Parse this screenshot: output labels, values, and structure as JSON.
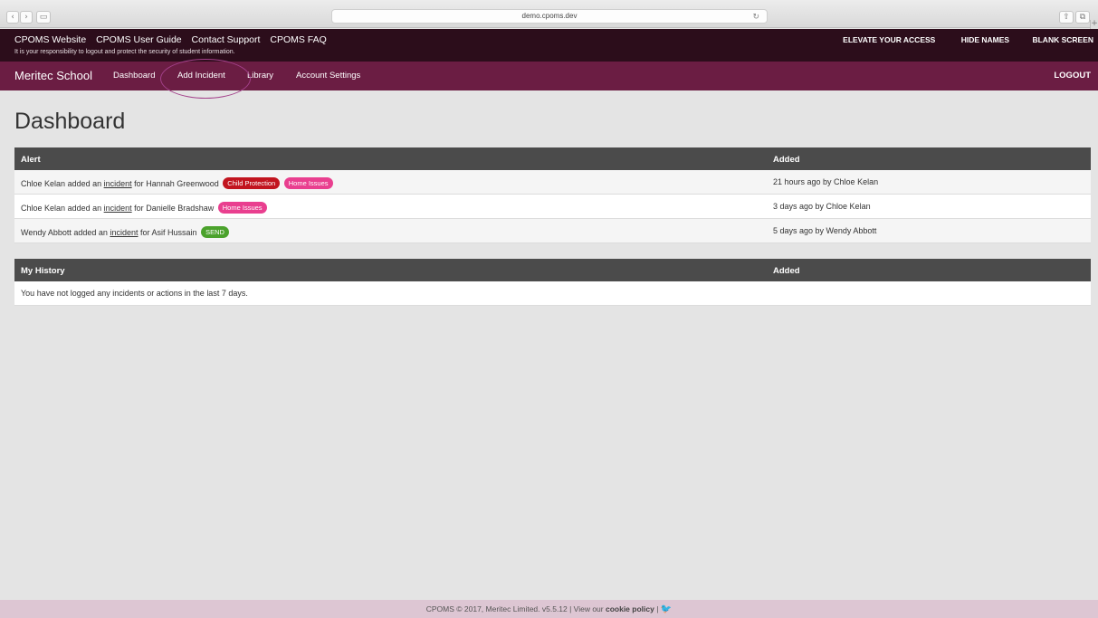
{
  "browser": {
    "url": "demo.cpoms.dev",
    "back_glyph": "‹",
    "forward_glyph": "›",
    "sidebar_glyph": "▭",
    "reload_glyph": "↻",
    "share_glyph": "⇧",
    "tabs_glyph": "⧉",
    "plus_glyph": "+"
  },
  "topbar": {
    "links": [
      "CPOMS Website",
      "CPOMS User Guide",
      "Contact Support",
      "CPOMS FAQ"
    ],
    "notice": "It is your responsibility to logout and protect the security of student information.",
    "right_links": [
      "ELEVATE YOUR ACCESS",
      "HIDE NAMES",
      "BLANK SCREEN"
    ]
  },
  "nav": {
    "brand": "Meritec School",
    "items": [
      "Dashboard",
      "Add Incident",
      "Library",
      "Account Settings"
    ],
    "logout": "LOGOUT"
  },
  "page": {
    "title": "Dashboard"
  },
  "alerts": {
    "headers": [
      "Alert",
      "Added"
    ],
    "rows": [
      {
        "user": "Chloe Kelan",
        "verb": "added an",
        "link": "incident",
        "for_text": "for",
        "student": "Hannah Greenwood",
        "badges": [
          "Child Protection",
          "Home Issues"
        ],
        "added": "21 hours ago by Chloe Kelan"
      },
      {
        "user": "Chloe Kelan",
        "verb": "added an",
        "link": "incident",
        "for_text": "for",
        "student": "Danielle Bradshaw",
        "badges": [
          "Home Issues"
        ],
        "added": "3 days ago by Chloe Kelan"
      },
      {
        "user": "Wendy Abbott",
        "verb": "added an",
        "link": "incident",
        "for_text": "for",
        "student": "Asif Hussain",
        "badges": [
          "SEND"
        ],
        "added": "5 days ago by Wendy Abbott"
      }
    ]
  },
  "history": {
    "headers": [
      "My History",
      "Added"
    ],
    "empty": "You have not logged any incidents or actions in the last 7 days."
  },
  "footer": {
    "text": "CPOMS © 2017, Meritec Limited. v5.5.12 | View our",
    "cookie": "cookie policy",
    "sep": "|",
    "twitter_glyph": "🐦"
  },
  "colors": {
    "topbar": "#2c0d1b",
    "nav": "#6b1d43",
    "table_header": "#4b4b4b",
    "badge_child_protection": "#c2151f",
    "badge_home_issues": "#e93f8f",
    "badge_send": "#4ba22c",
    "annotation_circle": "#a3408a"
  }
}
